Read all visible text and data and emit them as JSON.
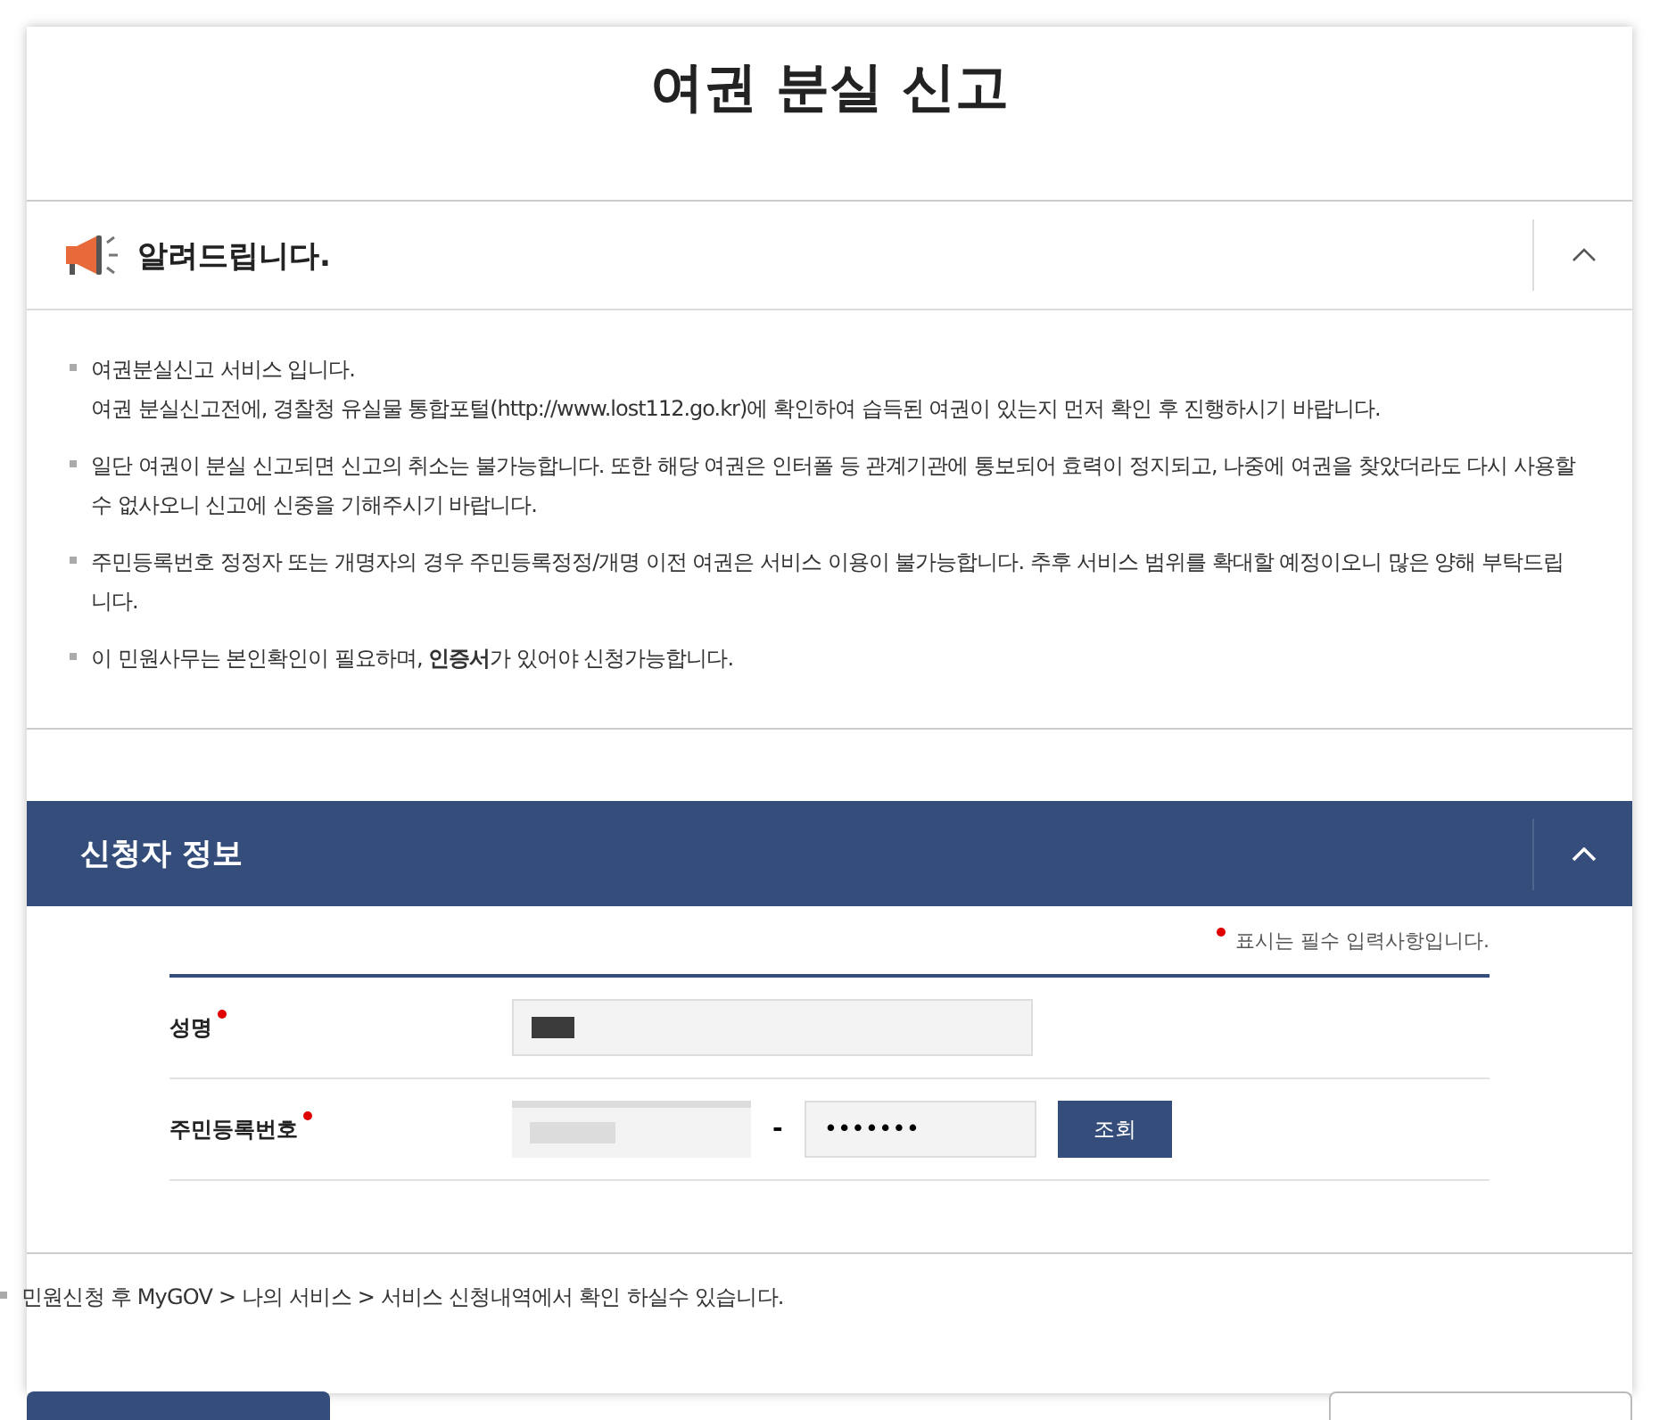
{
  "page_title": "여권 분실 신고",
  "notice": {
    "title": "알려드립니다.",
    "expanded": true,
    "items": [
      {
        "lines": [
          "여권분실신고 서비스 입니다.",
          "여권 분실신고전에, 경찰청 유실물 통합포털(http://www.lost112.go.kr)에 확인하여 습득된 여권이 있는지 먼저 확인 후 진행하시기 바랍니다."
        ]
      },
      {
        "lines": [
          "일단 여권이 분실 신고되면 신고의 취소는 불가능합니다. 또한 해당 여권은 인터폴 등 관계기관에 통보되어 효력이 정지되고, 나중에 여권을 찾았더라도 다시 사용할 수 없사오니 신고에 신중을 기해주시기 바랍니다."
        ]
      },
      {
        "lines": [
          "주민등록번호 정정자 또는 개명자의 경우 주민등록정정/개명 이전 여권은 서비스 이용이 불가능합니다. 추후 서비스 범위를 확대할 예정이오니 많은 양해 부탁드립니다."
        ]
      },
      {
        "lines": [
          "이 민원사무는 본인확인이 필요하며, **인증서**가 있어야 신청가능합니다."
        ]
      }
    ]
  },
  "applicant": {
    "title": "신청자 정보",
    "expanded": true,
    "required_note": "표시는 필수 입력사항입니다.",
    "fields": [
      {
        "label": "성명",
        "required": true,
        "kind": "name"
      },
      {
        "label": "주민등록번호",
        "required": true,
        "kind": "rrn",
        "separator": "-",
        "masked_value": "•••••••",
        "button": "조회"
      }
    ]
  },
  "footer_note": "민원신청 후 MyGOV > 나의 서비스 > 서비스 신청내역에서 확인 하실수 있습니다.",
  "buttons": [
    {
      "kind": "primary"
    },
    {
      "kind": "secondary"
    }
  ]
}
